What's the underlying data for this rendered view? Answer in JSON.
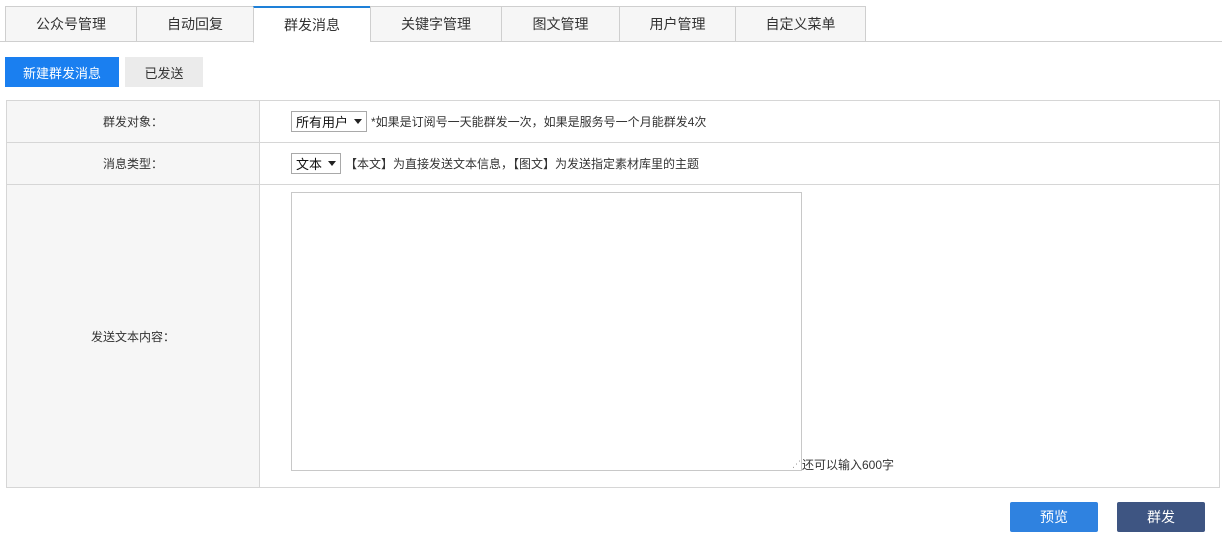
{
  "tabs": [
    {
      "label": "公众号管理"
    },
    {
      "label": "自动回复"
    },
    {
      "label": "群发消息"
    },
    {
      "label": "关键字管理"
    },
    {
      "label": "图文管理"
    },
    {
      "label": "用户管理"
    },
    {
      "label": "自定义菜单"
    }
  ],
  "active_tab": "群发消息",
  "sub_actions": {
    "new_label": "新建群发消息",
    "sent_label": "已发送"
  },
  "form": {
    "target": {
      "label": "群发对象：",
      "selected": "所有用户",
      "hint": "*如果是订阅号一天能群发一次，如果是服务号一个月能群发4次"
    },
    "type": {
      "label": "消息类型：",
      "selected": "文本",
      "hint": "【本文】为直接发送文本信息，【图文】为发送指定素材库里的主题"
    },
    "content": {
      "label": "发送文本内容：",
      "value": "",
      "counter": "还可以输入600字"
    }
  },
  "actions": {
    "preview_label": "预览",
    "send_label": "群发"
  },
  "colors": {
    "accent": "#1a7ff0",
    "send": "#3e5582",
    "preview": "#2f82e0"
  }
}
